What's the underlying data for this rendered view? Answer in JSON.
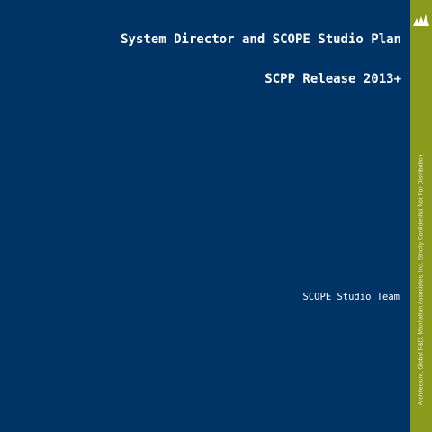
{
  "slide": {
    "title": "System Director and SCOPE Studio Plan",
    "subtitle": "SCPP Release 2013+",
    "team": "SCOPE Studio Team",
    "sidebar_text": "Architecture, Global R&D, Manhattan Associates, Inc.  Strictly Confidential  Not For Distribution",
    "logo_icon": "triangles-logo-icon",
    "colors": {
      "background": "#003366",
      "sidebar": "#8a9a1c",
      "text": "#ffffff"
    }
  }
}
